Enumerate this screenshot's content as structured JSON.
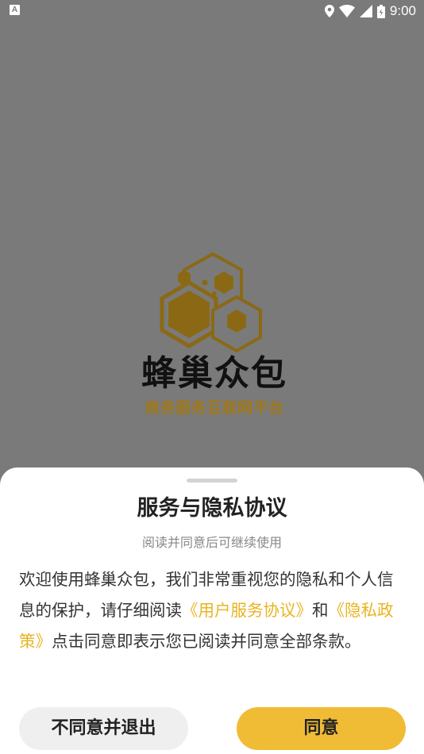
{
  "status_bar": {
    "time": "9:00"
  },
  "splash": {
    "app_name": "蜂巢众包",
    "tagline": "商务服务互联网平台"
  },
  "dialog": {
    "title": "服务与隐私协议",
    "subtitle": "阅读并同意后可继续使用",
    "body_prefix": "欢迎使用蜂巢众包，我们非常重视您的隐私和个人信息的保护，请仔细阅读",
    "link_user_agreement": "《用户服务协议》",
    "conjunction": "和",
    "link_privacy_policy": "《隐私政策》",
    "body_suffix": "点击同意即表示您已阅读并同意全部条款。",
    "decline_label": "不同意并退出",
    "agree_label": "同意"
  },
  "colors": {
    "accent": "#f0bc36",
    "link": "#e9b322",
    "logo_gold": "#8b6914",
    "overlay": "#7a7a7a"
  }
}
